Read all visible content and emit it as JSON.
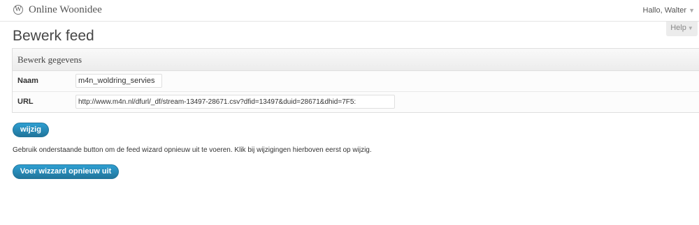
{
  "adminbar": {
    "site_name": "Online Woonidee",
    "greeting": "Hallo, Walter",
    "wp_icon": "wordpress-icon",
    "dropdown_icon": "▼"
  },
  "help": {
    "label": "Help",
    "arrow": "▼"
  },
  "page": {
    "title": "Bewerk feed"
  },
  "form": {
    "section_title": "Bewerk gegevens",
    "fields": [
      {
        "label": "Naam",
        "value": "m4n_woldring_servies"
      },
      {
        "label": "URL",
        "value": "http://www.m4n.nl/dfurl/_df/stream-13497-28671.csv?dfid=13497&duid=28671&dhid=7F5:"
      }
    ],
    "save_label": "wijzig"
  },
  "wizard": {
    "help_text": "Gebruik onderstaande button om de feed wizard opnieuw uit te voeren. Klik bij wijzigingen hierboven eerst op wijzig.",
    "button_label": "Voer wizzard opnieuw uit"
  },
  "colors": {
    "accent": "#21759b",
    "title": "#464646"
  }
}
